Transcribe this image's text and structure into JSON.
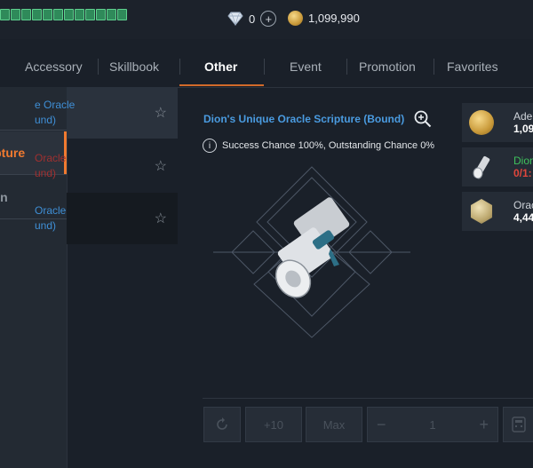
{
  "currency": {
    "diamond_count": "0",
    "adena_count": "1,099,990"
  },
  "tabs": [
    "Accessory",
    "Skillbook",
    "Other",
    "Event",
    "Promotion",
    "Favorites"
  ],
  "active_tab": "Other",
  "categories": [
    "",
    "cripture",
    "oken"
  ],
  "list_items": [
    {
      "line1": "e Oracle",
      "line2": "und)"
    },
    {
      "line1": "Oracle",
      "line2": "und)"
    },
    {
      "line1": "Oracle",
      "line2": "und)"
    }
  ],
  "detail": {
    "title": "Dion's Unique Oracle Scripture (Bound)",
    "chance_text": "Success Chance 100%, Outstanding Chance 0%"
  },
  "materials": [
    {
      "name": "Ade",
      "qty": "1,09",
      "icon": "adena-coin-icon"
    },
    {
      "name": "Dion",
      "qty": "0/1:",
      "icon": "scripture-scroll-icon"
    },
    {
      "name": "Orac",
      "qty": "4,44",
      "icon": "oracle-token-icon"
    }
  ],
  "controls": {
    "plus_ten": "+10",
    "max": "Max",
    "minus": "−",
    "quantity": "1",
    "plus": "+"
  },
  "colors": {
    "accent_orange": "#f07a30",
    "item_blue": "#3f8fd6",
    "item_red": "#a03030",
    "success_green": "#3ec25c",
    "warning_red": "#e0463c"
  }
}
